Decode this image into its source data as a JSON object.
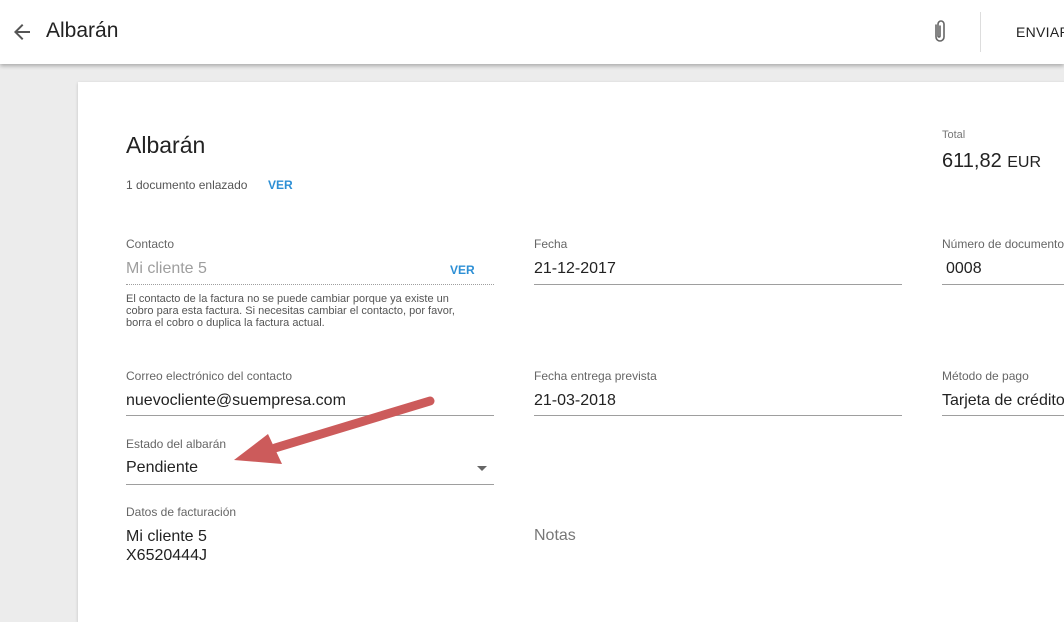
{
  "appbar": {
    "title": "Albarán",
    "send_label": "ENVIAR"
  },
  "doc": {
    "title": "Albarán",
    "linked_text": "1 documento enlazado",
    "linked_link": "VER",
    "total_label": "Total",
    "total_value": "611,82",
    "total_currency": "EUR"
  },
  "contact": {
    "label": "Contacto",
    "value": "Mi cliente 5",
    "link": "VER",
    "help_lines": [
      "El contacto de la factura no se puede cambiar porque ya existe un",
      "cobro para esta factura. Si necesitas cambiar el contacto, por favor,",
      "borra el cobro o duplica la factura actual."
    ]
  },
  "date": {
    "label": "Fecha",
    "value": "21-12-2017"
  },
  "doc_number": {
    "label": "Número de documento",
    "value": "0008"
  },
  "email": {
    "label": "Correo electrónico del contacto",
    "value": "nuevocliente@suempresa.com"
  },
  "delivery": {
    "label": "Fecha entrega prevista",
    "value": "21-03-2018"
  },
  "payment": {
    "label": "Método de pago",
    "value": "Tarjeta de crédito"
  },
  "status": {
    "label": "Estado del albarán",
    "value": "Pendiente"
  },
  "billing": {
    "label": "Datos de facturación",
    "line1": "Mi cliente 5",
    "line2": "X6520444J"
  },
  "notes": {
    "placeholder": "Notas"
  },
  "colors": {
    "accent": "#2d8fd5",
    "annotation_arrow": "#cc5b5b"
  },
  "icons": {
    "back": "arrow-left-icon",
    "attach": "paperclip-icon",
    "dropdown": "caret-down-icon"
  }
}
